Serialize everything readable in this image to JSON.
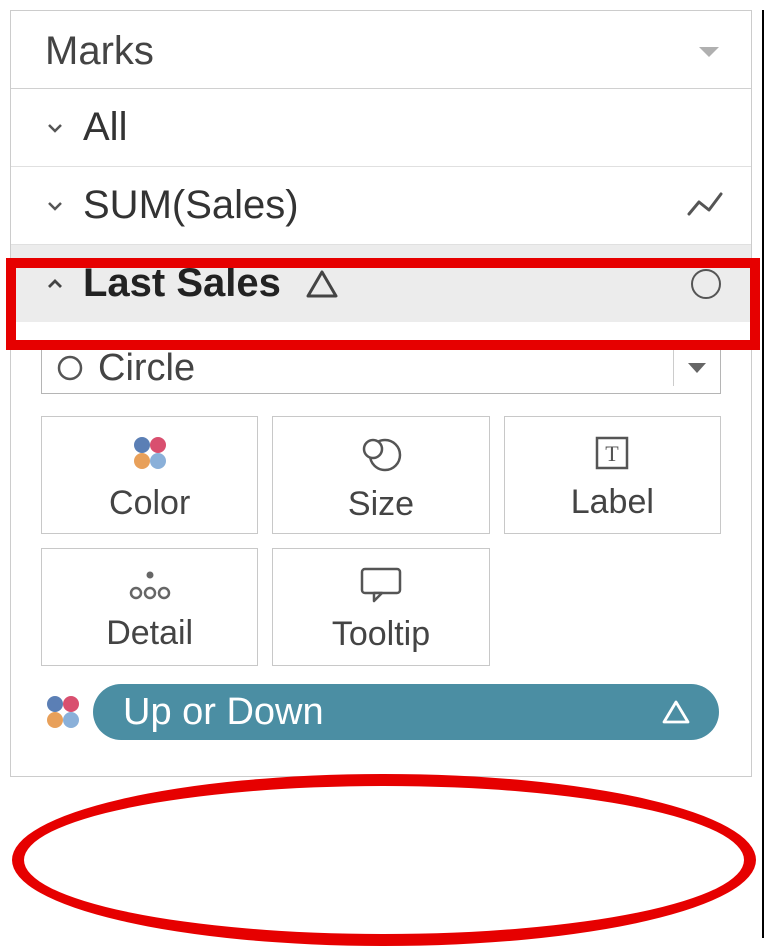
{
  "panel": {
    "title": "Marks",
    "rows": {
      "all": {
        "label": "All"
      },
      "sumSales": {
        "label": "SUM(Sales)"
      },
      "lastSales": {
        "label": "Last Sales"
      }
    },
    "markType": {
      "label": "Circle"
    },
    "tiles": {
      "color": "Color",
      "size": "Size",
      "label": "Label",
      "detail": "Detail",
      "tooltip": "Tooltip"
    },
    "pill": {
      "label": "Up or Down"
    }
  }
}
